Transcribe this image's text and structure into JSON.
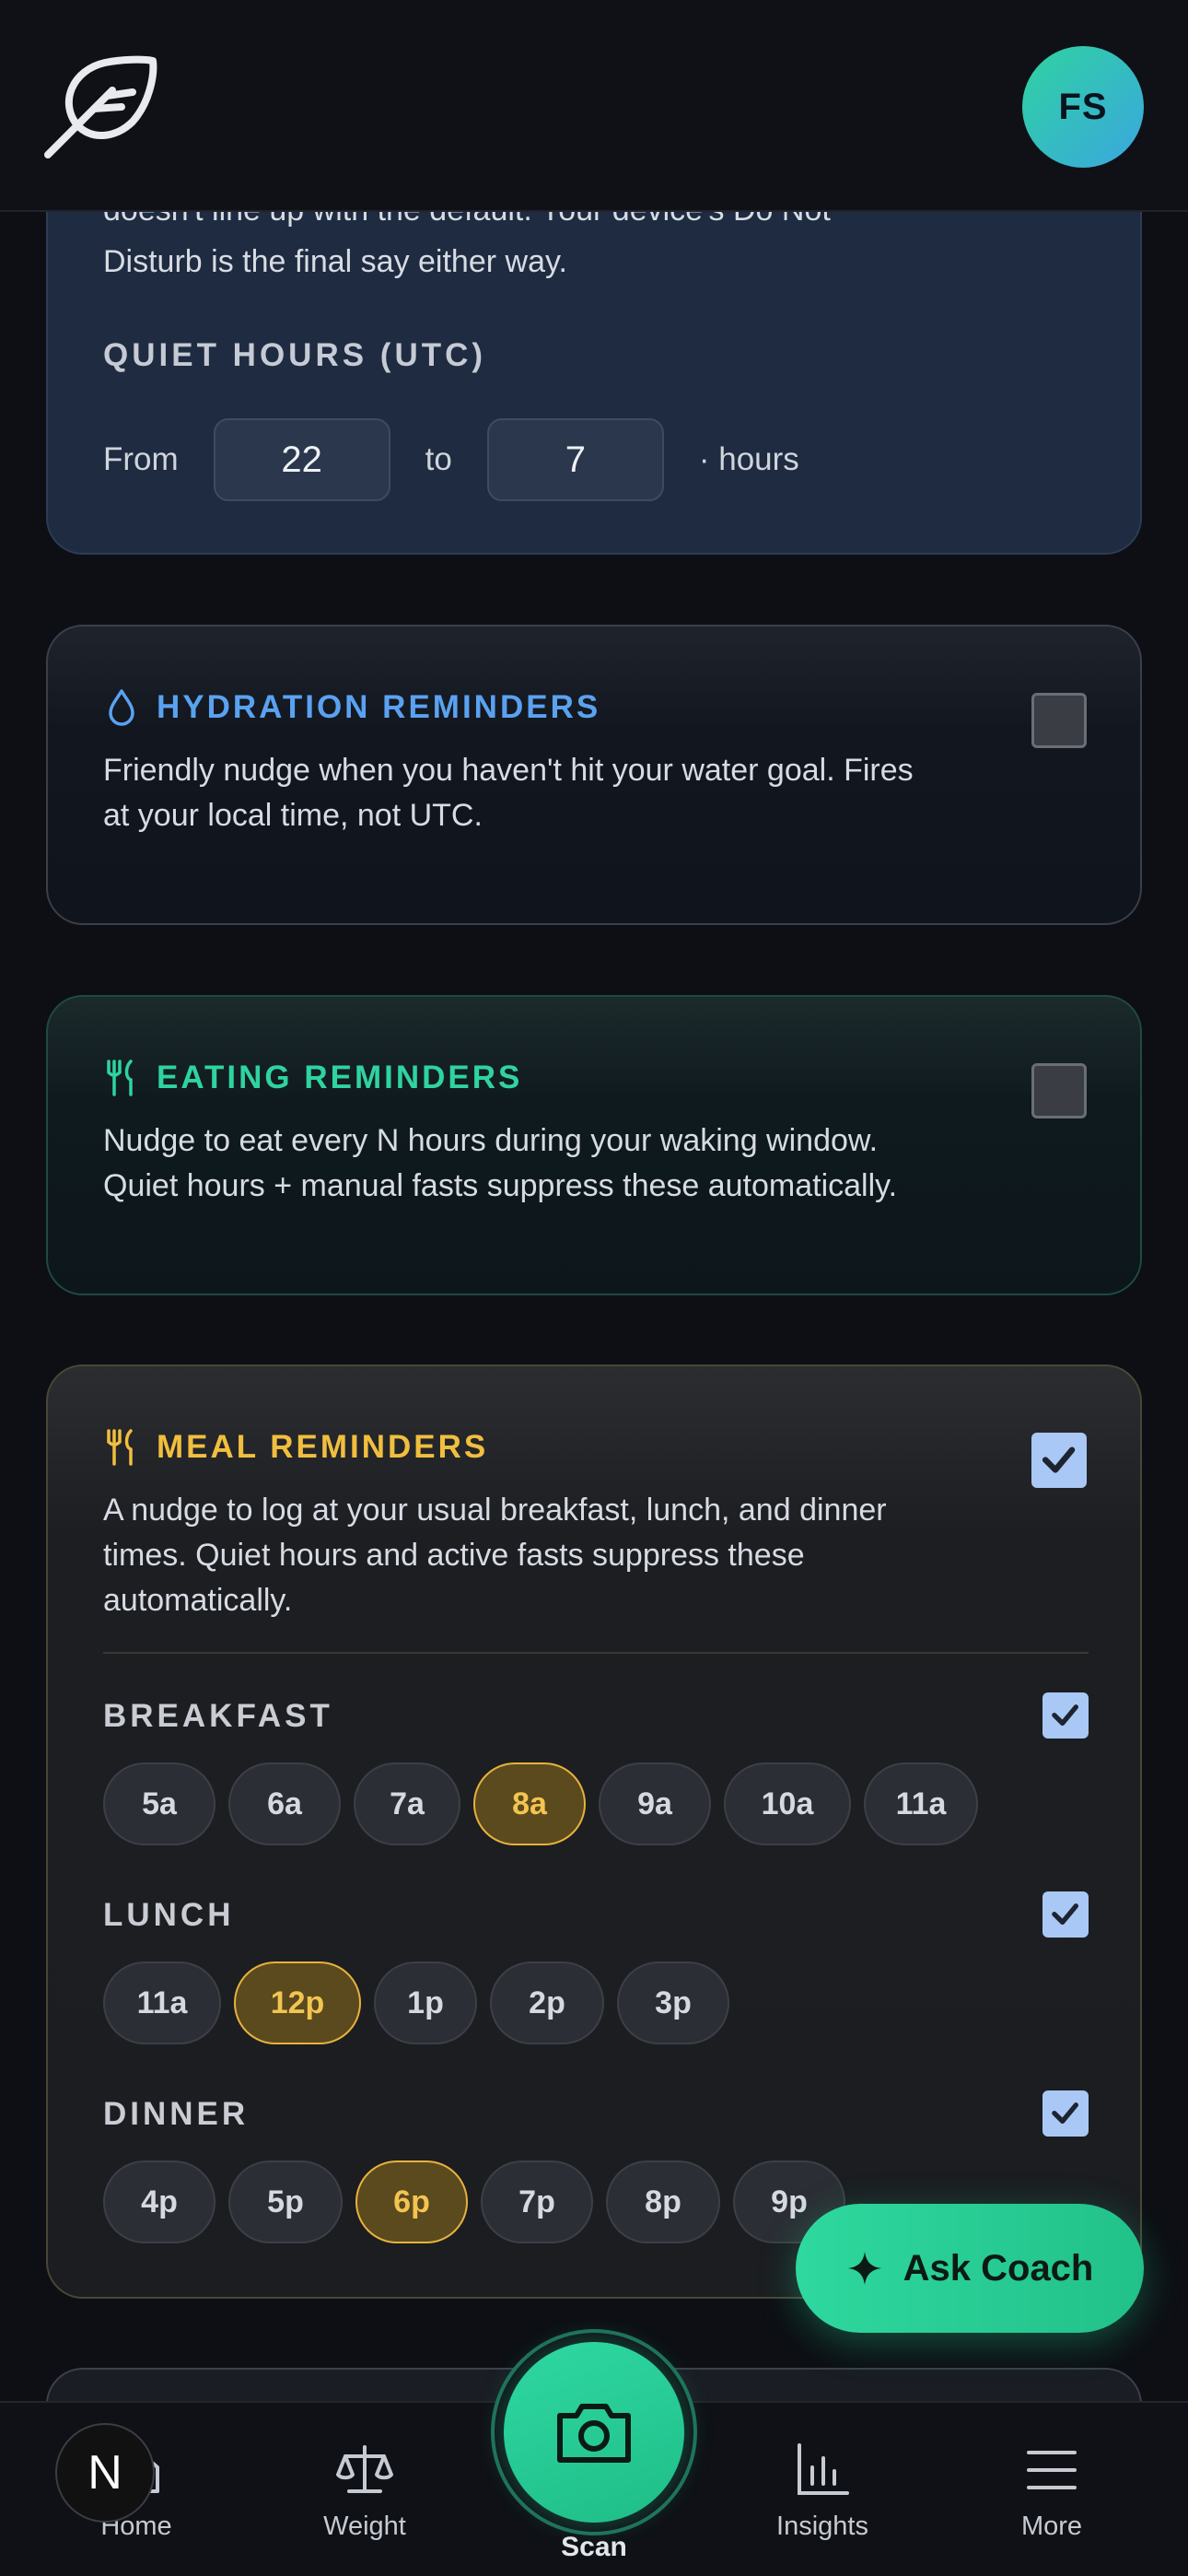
{
  "header": {
    "avatar_initials": "FS"
  },
  "quiet_hours": {
    "intro_line1": "doesn't line up with the default. Your device's Do Not",
    "intro_line2": "Disturb is the final say either way.",
    "section_label": "QUIET HOURS (UTC)",
    "from_label": "From",
    "from_value": "22",
    "to_label": "to",
    "to_value": "7",
    "suffix": "· hours"
  },
  "hydration": {
    "title": "HYDRATION REMINDERS",
    "desc_line1": "Friendly nudge when you haven't hit your water goal. Fires",
    "desc_line2": "at your local time, not UTC.",
    "enabled": false,
    "color": "#5aa2f0"
  },
  "eating": {
    "title": "EATING REMINDERS",
    "desc_line1": "Nudge to eat every N hours during your waking window.",
    "desc_line2": "Quiet hours + manual fasts suppress these automatically.",
    "enabled": false,
    "color": "#2fd3a0"
  },
  "meal": {
    "title": "MEAL REMINDERS",
    "desc_line1": "A nudge to log at your usual breakfast, lunch, and dinner",
    "desc_line2": "times. Quiet hours and active fasts suppress these",
    "desc_line3": "automatically.",
    "enabled": true,
    "color": "#f1be3e",
    "breakfast": {
      "label": "BREAKFAST",
      "enabled": true,
      "options": [
        "5a",
        "6a",
        "7a",
        "8a",
        "9a",
        "10a",
        "11a"
      ],
      "selected": "8a"
    },
    "lunch": {
      "label": "LUNCH",
      "enabled": true,
      "options": [
        "11a",
        "12p",
        "1p",
        "2p",
        "3p"
      ],
      "selected": "12p"
    },
    "dinner": {
      "label": "DINNER",
      "enabled": true,
      "options": [
        "4p",
        "5p",
        "6p",
        "7p",
        "8p",
        "9p"
      ],
      "selected": "6p"
    }
  },
  "fab": {
    "label": "Ask Coach"
  },
  "bottom_nav": {
    "home": "Home",
    "weight": "Weight",
    "scan": "Scan",
    "insights": "Insights",
    "more": "More",
    "badge_letter": "N"
  }
}
